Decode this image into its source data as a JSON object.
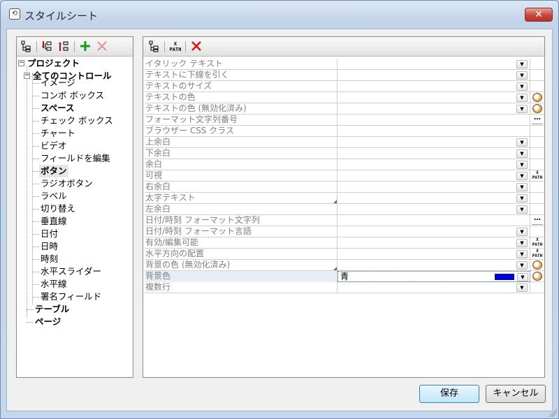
{
  "window": {
    "title": "スタイルシート",
    "close_label": "✕"
  },
  "left_toolbar": {
    "buttons": [
      "tree-icon",
      "insert-before-icon",
      "insert-after-icon",
      "add-icon",
      "delete-icon"
    ]
  },
  "tree": {
    "items": [
      {
        "label": "プロジェクト",
        "bold": true,
        "level": 0,
        "toggle": "⊟"
      },
      {
        "label": "全てのコントロール",
        "bold": true,
        "level": 1,
        "toggle": "⊟"
      },
      {
        "label": "イメージ",
        "bold": false,
        "level": 2
      },
      {
        "label": "コンボ ボックス",
        "bold": false,
        "level": 2
      },
      {
        "label": "スペース",
        "bold": true,
        "level": 2
      },
      {
        "label": "チェック ボックス",
        "bold": false,
        "level": 2
      },
      {
        "label": "チャート",
        "bold": false,
        "level": 2
      },
      {
        "label": "ビデオ",
        "bold": false,
        "level": 2
      },
      {
        "label": "フィールドを編集",
        "bold": false,
        "level": 2
      },
      {
        "label": "ボタン",
        "bold": true,
        "level": 2,
        "selected": true
      },
      {
        "label": "ラジオボタン",
        "bold": false,
        "level": 2
      },
      {
        "label": "ラベル",
        "bold": false,
        "level": 2
      },
      {
        "label": "切り替え",
        "bold": false,
        "level": 2
      },
      {
        "label": "垂直線",
        "bold": false,
        "level": 2
      },
      {
        "label": "日付",
        "bold": false,
        "level": 2
      },
      {
        "label": "日時",
        "bold": false,
        "level": 2
      },
      {
        "label": "時刻",
        "bold": false,
        "level": 2
      },
      {
        "label": "水平スライダー",
        "bold": false,
        "level": 2
      },
      {
        "label": "水平線",
        "bold": false,
        "level": 2
      },
      {
        "label": "署名フィールド",
        "bold": false,
        "level": 2
      },
      {
        "label": "テーブル",
        "bold": true,
        "level": 1
      },
      {
        "label": "ページ",
        "bold": true,
        "level": 1
      }
    ]
  },
  "right_toolbar": {
    "buttons": [
      "tree-icon",
      "xpath-icon",
      "delete-icon"
    ],
    "xpath_label": "X PATH"
  },
  "properties": [
    {
      "name": "イタリック テキスト",
      "value": "",
      "dropdown": true,
      "extra": ""
    },
    {
      "name": "テキストに下線を引く",
      "value": "",
      "dropdown": true,
      "extra": ""
    },
    {
      "name": "テキストのサイズ",
      "value": "",
      "dropdown": true,
      "extra": ""
    },
    {
      "name": "テキストの色",
      "value": "",
      "dropdown": true,
      "extra": "palette"
    },
    {
      "name": "テキストの色 (無効化済み)",
      "value": "",
      "dropdown": true,
      "extra": "palette"
    },
    {
      "name": "フォーマット文字列番号",
      "value": "",
      "dropdown": false,
      "extra": "ellipsis"
    },
    {
      "name": "ブラウザー CSS クラス",
      "value": "",
      "dropdown": false,
      "extra": ""
    },
    {
      "name": "上余白",
      "value": "",
      "dropdown": true,
      "extra": ""
    },
    {
      "name": "下余白",
      "value": "",
      "dropdown": true,
      "extra": ""
    },
    {
      "name": "余白",
      "value": "",
      "dropdown": true,
      "extra": ""
    },
    {
      "name": "可視",
      "value": "",
      "dropdown": true,
      "extra": "xpath"
    },
    {
      "name": "右余白",
      "value": "",
      "dropdown": true,
      "extra": ""
    },
    {
      "name": "太字テキスト",
      "value": "",
      "dropdown": true,
      "extra": "",
      "marker": true
    },
    {
      "name": "左余白",
      "value": "",
      "dropdown": true,
      "extra": ""
    },
    {
      "name": "日付/時刻 フォーマット文字列",
      "value": "",
      "dropdown": false,
      "extra": "ellipsis"
    },
    {
      "name": "日付/時刻 フォーマット言語",
      "value": "",
      "dropdown": true,
      "extra": ""
    },
    {
      "name": "有効/編集可能",
      "value": "",
      "dropdown": true,
      "extra": "xpath"
    },
    {
      "name": "水平方向の配置",
      "value": "",
      "dropdown": true,
      "extra": "xpath"
    },
    {
      "name": "背景の色 (無効化済み)",
      "value": "",
      "dropdown": true,
      "extra": "palette",
      "marker": true
    },
    {
      "name": "背景色",
      "value": "青",
      "dropdown": true,
      "extra": "palette",
      "selected": true,
      "swatch": "#0000e0"
    },
    {
      "name": "複数行",
      "value": "",
      "dropdown": true,
      "extra": ""
    }
  ],
  "buttons": {
    "save": "保存",
    "cancel": "キャンセル"
  },
  "colors": {
    "accent": "#3c7fb1",
    "swatch": "#0000e0",
    "marker": "#2a9a2a"
  }
}
